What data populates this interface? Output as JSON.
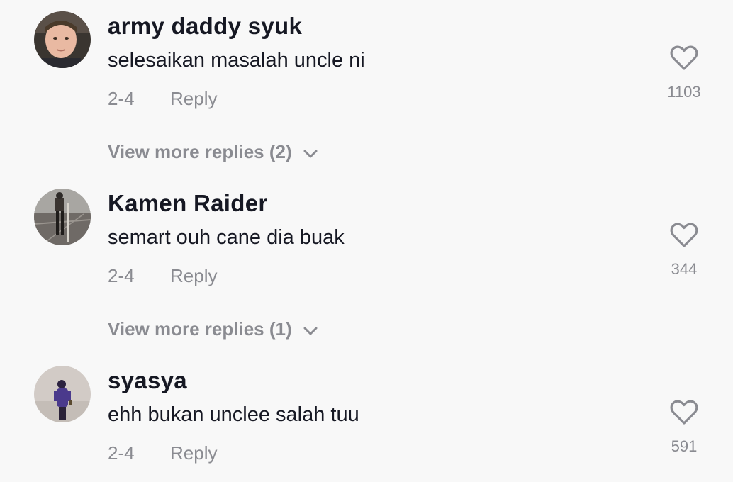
{
  "comments": [
    {
      "username": "army daddy syuk",
      "text": "selesaikan masalah uncle ni",
      "date": "2-4",
      "reply_label": "Reply",
      "likes": "1103",
      "view_more": "View more replies (2)",
      "heart_icon": "heart-outline-icon",
      "chevron_icon": "chevron-down-icon"
    },
    {
      "username": "Kamen Raider",
      "text": "semart ouh cane dia buak",
      "date": "2-4",
      "reply_label": "Reply",
      "likes": "344",
      "view_more": "View more replies (1)",
      "heart_icon": "heart-outline-icon",
      "chevron_icon": "chevron-down-icon"
    },
    {
      "username": "syasya",
      "text": "ehh bukan unclee salah tuu",
      "date": "2-4",
      "reply_label": "Reply",
      "likes": "591",
      "heart_icon": "heart-outline-icon"
    }
  ],
  "colors": {
    "background": "#f8f8f8",
    "username": "#161823",
    "secondary": "#8a8b91"
  }
}
